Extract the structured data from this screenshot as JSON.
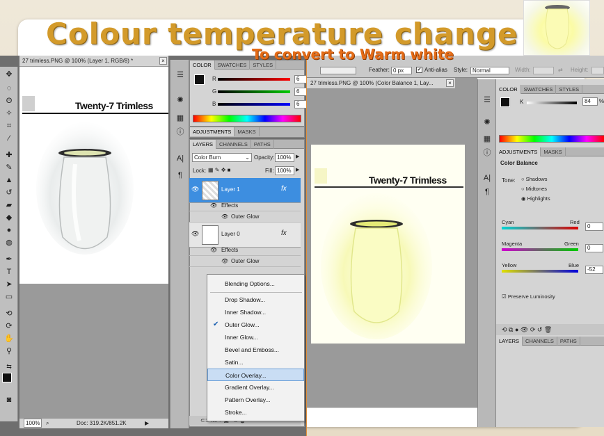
{
  "slide": {
    "title": "Colour temperature change",
    "subtitle": "To convert to Warm white"
  },
  "left_window": {
    "doc_tab": "27 trimless.PNG @ 100% (Layer 1, RGB/8) *",
    "doc_tab_close": "×",
    "brand_text": "Twenty-7 Trimless",
    "zoom": "100%",
    "doc_info": "Doc: 319.2K/851.2K"
  },
  "color_panel": {
    "tabs": [
      "COLOR",
      "SWATCHES",
      "STYLES"
    ],
    "channels": [
      {
        "label": "R",
        "value": "6"
      },
      {
        "label": "G",
        "value": "6"
      },
      {
        "label": "B",
        "value": "6"
      }
    ]
  },
  "adjust_tabs": [
    "ADJUSTMENTS",
    "MASKS"
  ],
  "layers_panel": {
    "tabs": [
      "LAYERS",
      "CHANNELS",
      "PATHS"
    ],
    "blend_mode": "Color Burn",
    "opacity_label": "Opacity:",
    "opacity_value": "100%",
    "lock_label": "Lock:",
    "fill_label": "Fill:",
    "fill_value": "100%",
    "layers": [
      {
        "name": "Layer 1",
        "fx": "fx",
        "effects": "Effects",
        "effect_item": "Outer Glow"
      },
      {
        "name": "Layer 0",
        "fx": "fx",
        "effects": "Effects",
        "effect_item": "Outer Glow"
      }
    ]
  },
  "context_menu": {
    "items": [
      "Blending Options...",
      "Drop Shadow...",
      "Inner Shadow...",
      "Outer Glow...",
      "Inner Glow...",
      "Bevel and Emboss...",
      "Satin...",
      "Color Overlay...",
      "Gradient Overlay...",
      "Pattern Overlay...",
      "Stroke..."
    ],
    "checked_item": "Outer Glow...",
    "highlighted_item": "Color Overlay...",
    "check_mark": "✔"
  },
  "right_window": {
    "options": {
      "feather_label": "Feather:",
      "feather_value": "0 px",
      "antialias_label": "Anti-alias",
      "style_label": "Style:",
      "style_value": "Normal",
      "width_label": "Width:",
      "height_label": "Height:"
    },
    "doc_tab": "27 trimless.PNG @ 100% (Color Balance 1, Lay...",
    "doc_tab_close": "×",
    "brand_text": "Twenty-7 Trimless",
    "color_tabs": [
      "COLOR",
      "SWATCHES",
      "STYLES"
    ],
    "k_label": "K",
    "k_value": "84",
    "k_unit": "%",
    "adjust_tabs": [
      "ADJUSTMENTS",
      "MASKS"
    ],
    "adjust_title": "Color Balance",
    "tone_label": "Tone:",
    "tone_options": [
      "Shadows",
      "Midtones",
      "Highlights"
    ],
    "tone_selected": "Highlights",
    "balance": [
      {
        "left": "Cyan",
        "right": "Red",
        "value": "0"
      },
      {
        "left": "Magenta",
        "right": "Green",
        "value": "0"
      },
      {
        "left": "Yellow",
        "right": "Blue",
        "value": "-52"
      }
    ],
    "preserve_label": "Preserve Luminosity",
    "bottom_tabs": [
      "LAYERS",
      "CHANNELS",
      "PATHS"
    ]
  },
  "colors": {
    "title_gold": "#d39a2a",
    "subtitle_orange": "#e46b16",
    "layer_selected": "#3d8ee0",
    "menu_highlight": "#c9ddf4"
  }
}
